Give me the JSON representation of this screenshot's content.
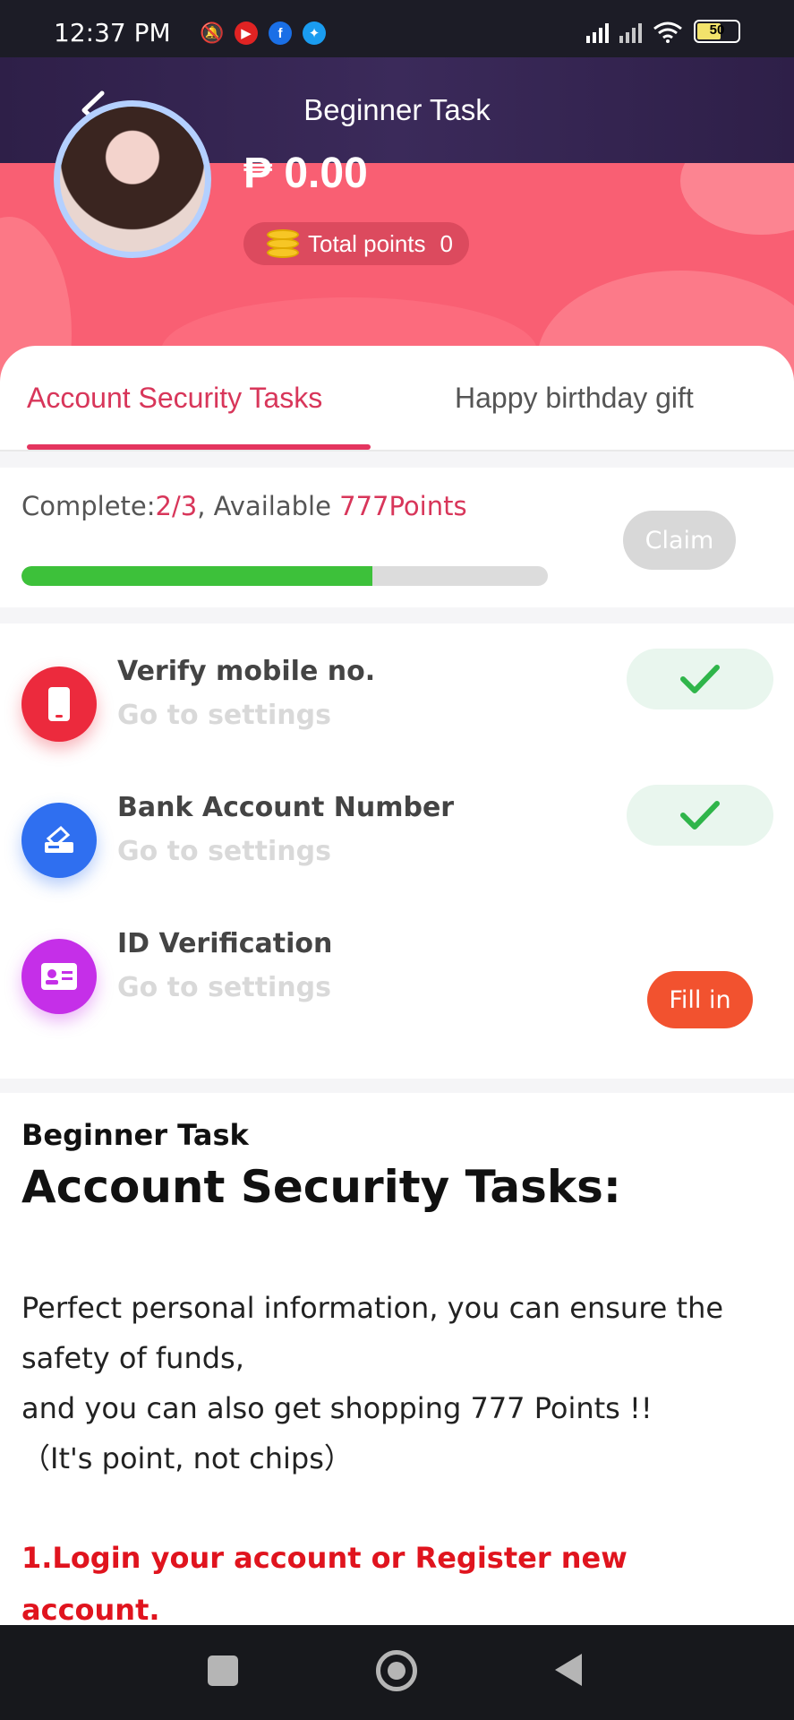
{
  "status_bar": {
    "time": "12:37 PM",
    "battery": "50"
  },
  "header": {
    "title": "Beginner Task"
  },
  "profile": {
    "balance": "₱ 0.00",
    "total_points_label": "Total points",
    "total_points_value": "0"
  },
  "tabs": [
    {
      "label": "Account Security Tasks",
      "active": true
    },
    {
      "label": "Happy birthday gift",
      "active": false
    }
  ],
  "progress": {
    "complete_label": "Complete:",
    "complete_value": "2/3",
    "separator": ", Available ",
    "available_value": "777Points",
    "fraction": 0.667,
    "claim_label": "Claim"
  },
  "tasks": [
    {
      "title": "Verify mobile no.",
      "subtitle": "Go to settings",
      "status": "done",
      "icon": "phone-icon"
    },
    {
      "title": "Bank Account Number",
      "subtitle": "Go to settings",
      "status": "done",
      "icon": "bank-card-icon"
    },
    {
      "title": "ID Verification",
      "subtitle": "Go to settings",
      "status": "pending",
      "action_label": "Fill in",
      "icon": "id-card-icon"
    }
  ],
  "article": {
    "heading_small": "Beginner Task",
    "heading_large": "Account Security Tasks:",
    "line1": "Perfect personal information, you can ensure the safety of funds,",
    "line2": "and you can also get shopping 777 Points !!",
    "line3": "（It's point, not chips）",
    "step1": "1.Login your account or Register new account."
  },
  "colors": {
    "accent": "#d8365a",
    "hero": "#f95f73",
    "progress_fill": "#3dc13a",
    "fill_in_button": "#f2522f",
    "step_red": "#e0141e"
  }
}
